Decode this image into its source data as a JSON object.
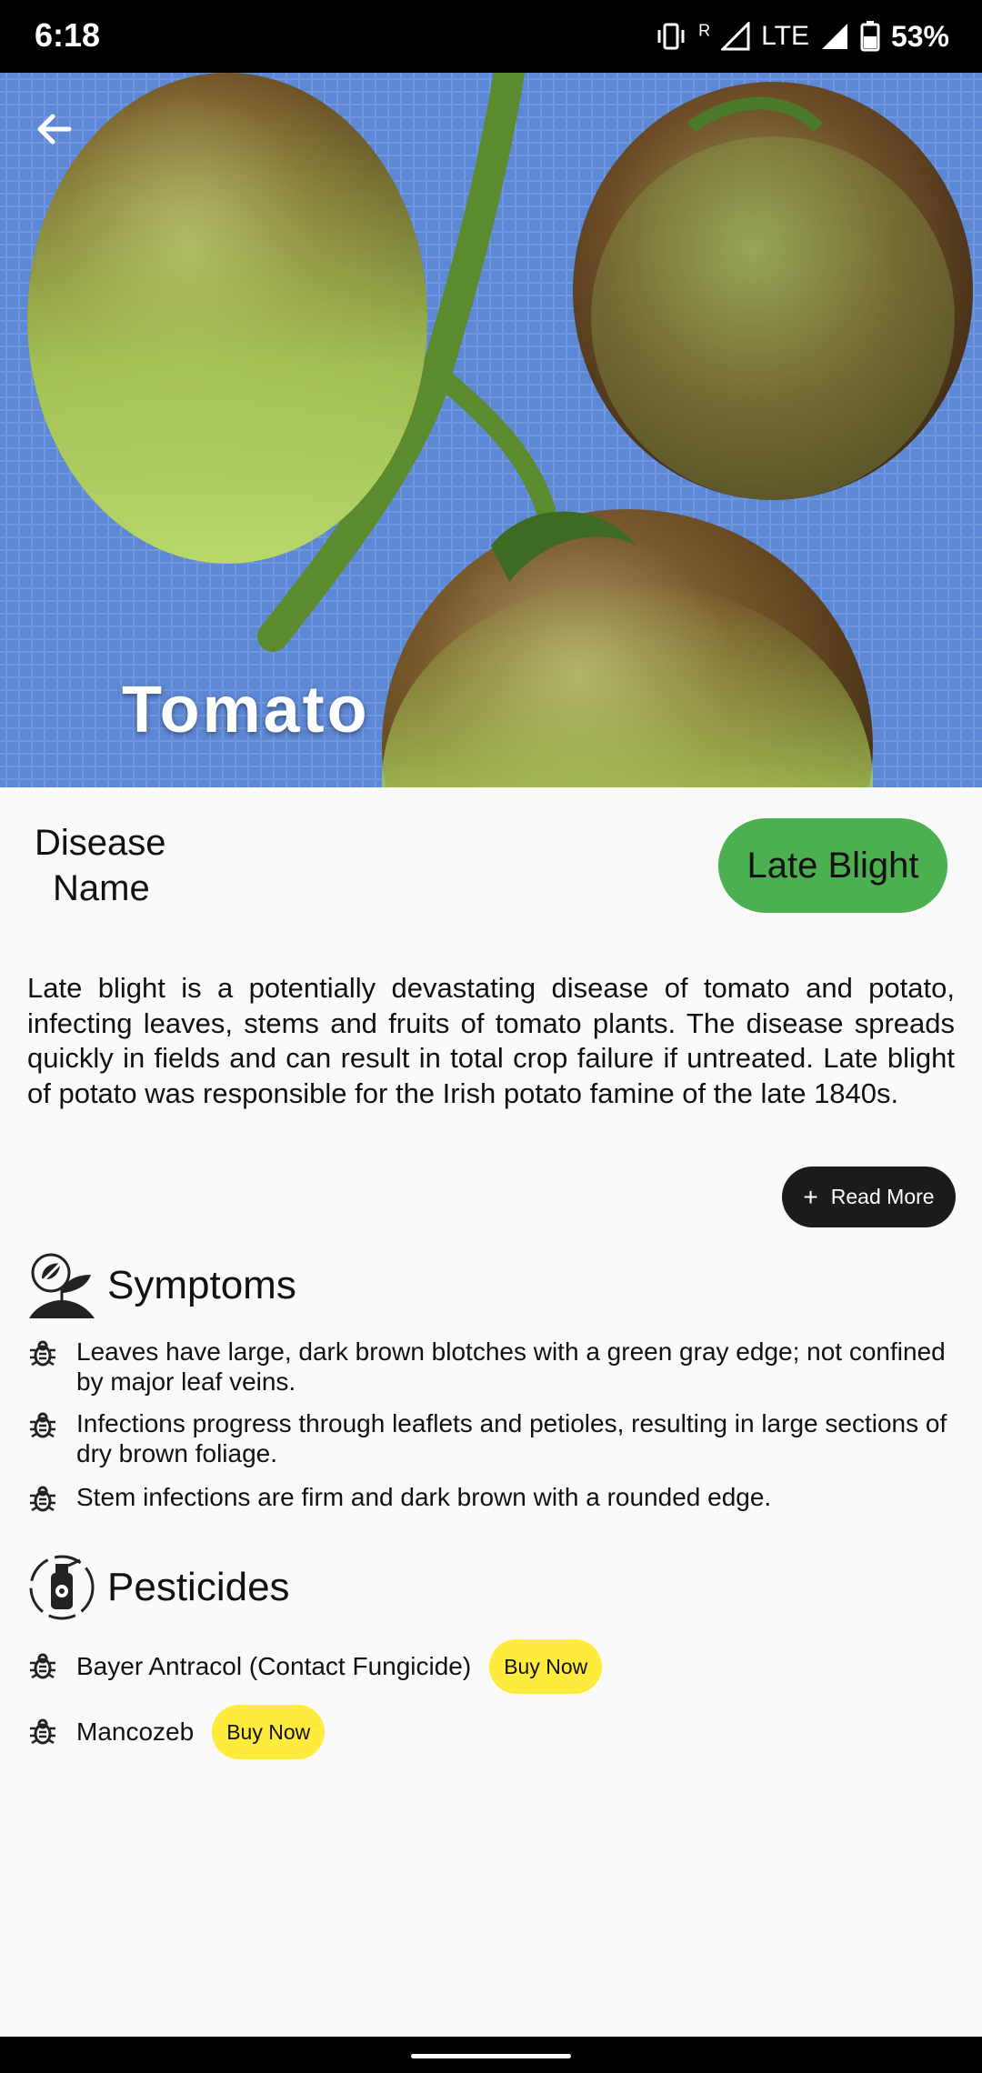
{
  "status_bar": {
    "time": "6:18",
    "network_r": "R",
    "network": "LTE",
    "battery": "53%"
  },
  "hero": {
    "title": "Tomato",
    "back_icon": "arrow-back-icon"
  },
  "disease": {
    "label_line1": "Disease",
    "label_line2": "Name",
    "name": "Late Blight"
  },
  "description": "Late blight is a potentially devastating disease of tomato and potato, infecting leaves, stems and fruits of tomato plants. The disease spreads quickly in fields and can result in total crop failure if untreated. Late blight of potato was responsible for the Irish potato famine of the late 1840s.",
  "read_more": {
    "icon": "plus-icon",
    "label": "Read More"
  },
  "symptoms": {
    "title": "Symptoms",
    "icon": "plant-disease-icon",
    "items": [
      "Leaves have large, dark brown blotches with a green gray edge; not confined by major leaf veins.",
      "Infections progress through leaflets and petioles, resulting in large sections of dry brown foliage.",
      "Stem infections are firm and dark brown with a rounded edge."
    ]
  },
  "pesticides": {
    "title": "Pesticides",
    "icon": "pesticide-spray-icon",
    "items": [
      {
        "name": "Bayer Antracol (Contact Fungicide)",
        "button": "Buy Now"
      },
      {
        "name": "Mancozeb",
        "button": "Buy Now"
      }
    ]
  },
  "colors": {
    "disease_chip": "#4caf50",
    "buy_button": "#ffeb3b",
    "read_more_button": "#1b1b1b"
  }
}
